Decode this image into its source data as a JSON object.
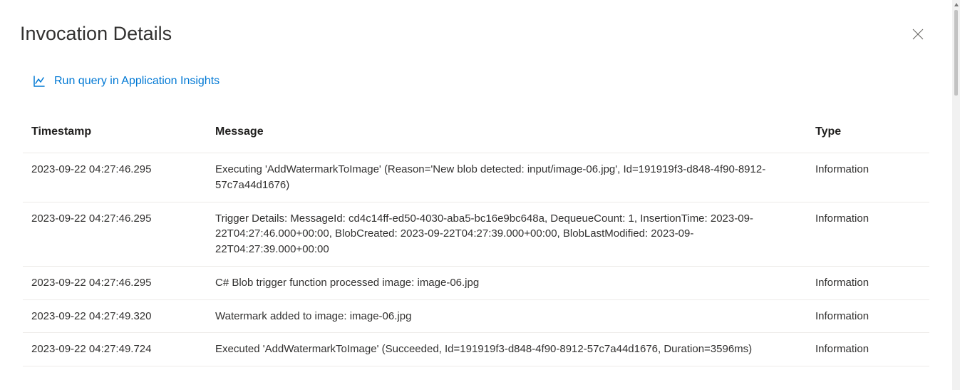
{
  "title": "Invocation Details",
  "link": {
    "label": "Run query in Application Insights"
  },
  "table": {
    "headers": {
      "timestamp": "Timestamp",
      "message": "Message",
      "type": "Type"
    },
    "rows": [
      {
        "timestamp": "2023-09-22 04:27:46.295",
        "message": "Executing 'AddWatermarkToImage' (Reason='New blob detected: input/image-06.jpg', Id=191919f3-d848-4f90-8912-57c7a44d1676)",
        "type": "Information"
      },
      {
        "timestamp": "2023-09-22 04:27:46.295",
        "message": "Trigger Details: MessageId: cd4c14ff-ed50-4030-aba5-bc16e9bc648a, DequeueCount: 1, InsertionTime: 2023-09-22T04:27:46.000+00:00, BlobCreated: 2023-09-22T04:27:39.000+00:00, BlobLastModified: 2023-09-22T04:27:39.000+00:00",
        "type": "Information"
      },
      {
        "timestamp": "2023-09-22 04:27:46.295",
        "message": "C# Blob trigger function processed image: image-06.jpg",
        "type": "Information"
      },
      {
        "timestamp": "2023-09-22 04:27:49.320",
        "message": "Watermark added to image: image-06.jpg",
        "type": "Information"
      },
      {
        "timestamp": "2023-09-22 04:27:49.724",
        "message": "Executed 'AddWatermarkToImage' (Succeeded, Id=191919f3-d848-4f90-8912-57c7a44d1676, Duration=3596ms)",
        "type": "Information"
      }
    ]
  }
}
